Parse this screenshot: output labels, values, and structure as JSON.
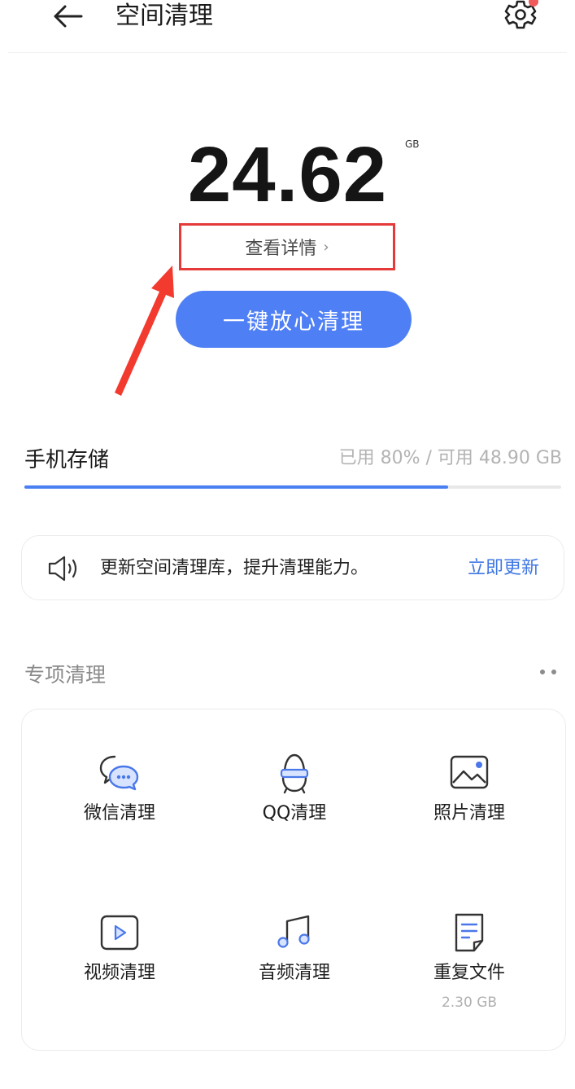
{
  "header": {
    "title": "空间清理",
    "back_icon": "back-arrow-icon",
    "settings_icon": "gear-icon",
    "has_notification": true
  },
  "storage": {
    "amount": "24.62",
    "unit": "GB",
    "details_label": "查看详情",
    "details_chevron": "›",
    "clean_button_label": "一键放心清理"
  },
  "phone_storage": {
    "label": "手机存储",
    "stats": "已用 80% / 可用 48.90 GB",
    "used_fraction": 0.79
  },
  "notice": {
    "icon": "speaker-icon",
    "text": "更新空间清理库，提升清理能力。",
    "action": "立即更新"
  },
  "special_cleaning": {
    "title": "专项清理",
    "more_icon": "more-dots-icon",
    "items": [
      {
        "label": "微信清理",
        "icon": "wechat-icon",
        "sub": ""
      },
      {
        "label": "QQ清理",
        "icon": "qq-icon",
        "sub": ""
      },
      {
        "label": "照片清理",
        "icon": "photo-icon",
        "sub": ""
      },
      {
        "label": "视频清理",
        "icon": "video-icon",
        "sub": ""
      },
      {
        "label": "音频清理",
        "icon": "music-icon",
        "sub": ""
      },
      {
        "label": "重复文件",
        "icon": "document-icon",
        "sub": "2.30 GB"
      }
    ]
  },
  "colors": {
    "accent": "#4f7ff5",
    "link": "#3f77e4",
    "annotation_red": "#e63a3a",
    "notification": "#f05a5a"
  }
}
